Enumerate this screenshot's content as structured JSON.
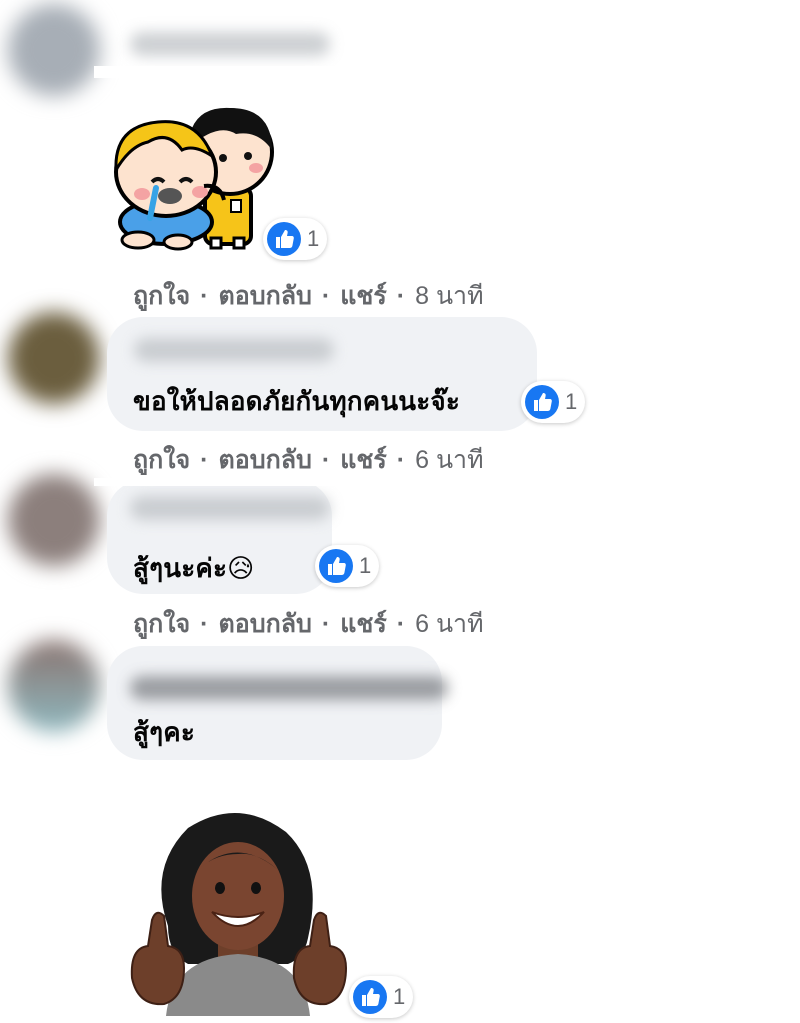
{
  "colors": {
    "bubble_bg": "#f0f2f5",
    "meta_text": "#65676b",
    "like_blue": "#1877f2",
    "text": "#050505"
  },
  "comments": [
    {
      "type": "sticker",
      "sticker": "crying-boy-comforted-by-girl-sticker",
      "reaction_icon": "like-icon",
      "reaction_count": "1",
      "actions": {
        "like": "ถูกใจ",
        "reply": "ตอบกลับ",
        "share": "แชร์",
        "time": "8 นาที"
      }
    },
    {
      "type": "text",
      "text": "ขอให้ปลอดภัยกันทุกคนนะจ๊ะ",
      "reaction_icon": "like-icon",
      "reaction_count": "1",
      "actions": {
        "like": "ถูกใจ",
        "reply": "ตอบกลับ",
        "share": "แชร์",
        "time": "6 นาที"
      }
    },
    {
      "type": "text",
      "text": "สู้ๆนะค่ะ",
      "emoji": "😥",
      "reaction_icon": "like-icon",
      "reaction_count": "1",
      "actions": {
        "like": "ถูกใจ",
        "reply": "ตอบกลับ",
        "share": "แชร์",
        "time": "6 นาที"
      }
    },
    {
      "type": "text",
      "text": "สู้ๆคะ"
    },
    {
      "type": "avatar-sticker",
      "sticker": "thumbs-up-avatar-sticker",
      "reaction_icon": "like-icon",
      "reaction_count": "1"
    }
  ],
  "separator": "·"
}
